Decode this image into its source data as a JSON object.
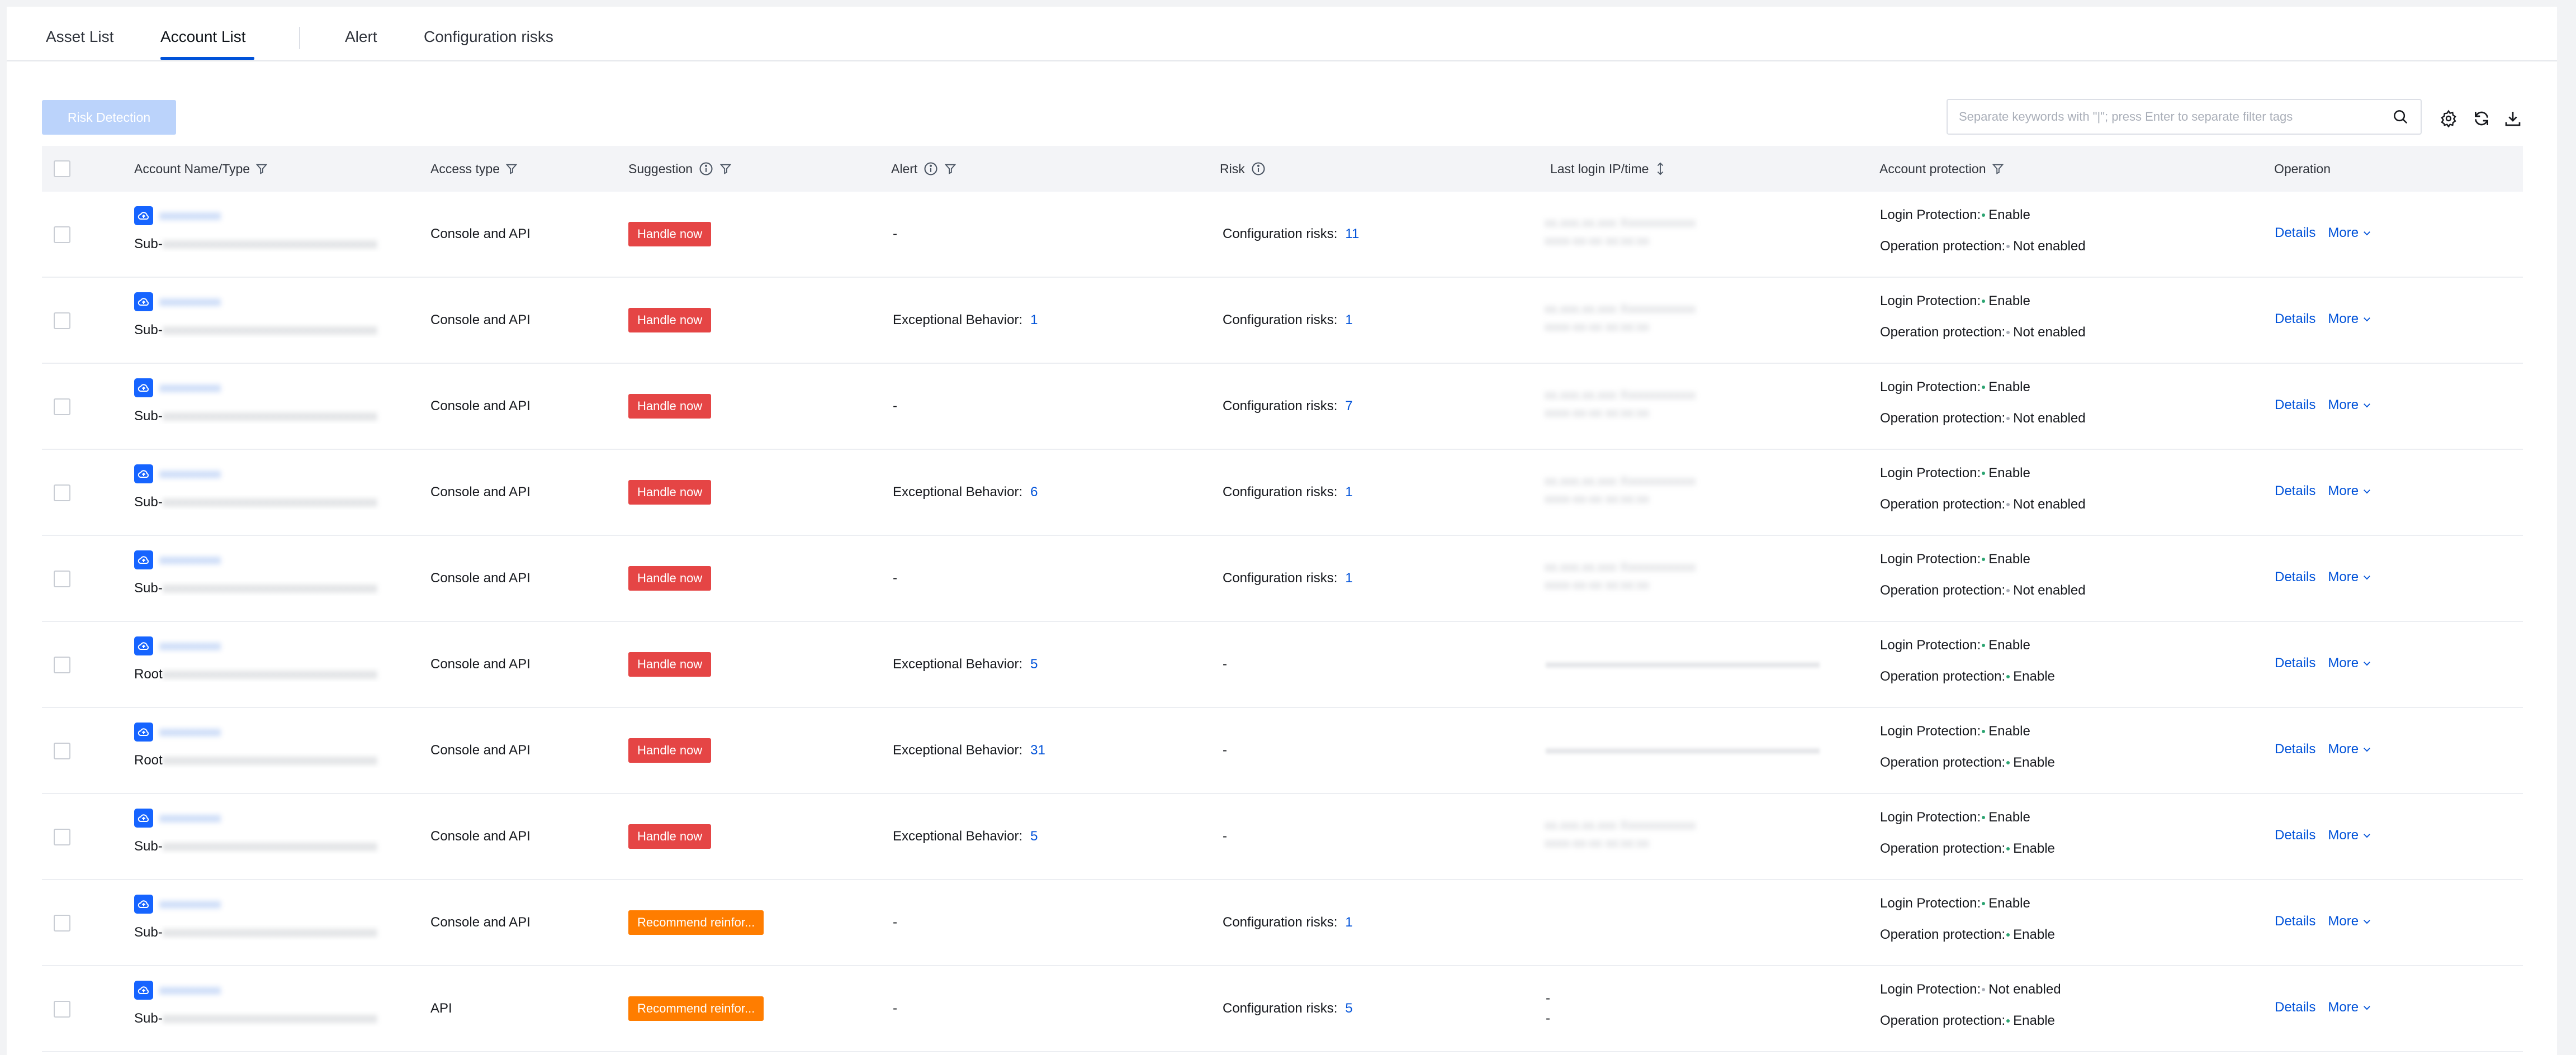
{
  "tabs": [
    {
      "label": "Asset List"
    },
    {
      "label": "Account List"
    },
    {
      "label": "Alert"
    },
    {
      "label": "Configuration risks"
    }
  ],
  "toolbar": {
    "risk_button": "Risk Detection",
    "search_placeholder": "Separate keywords with \"|\"; press Enter to separate filter tags"
  },
  "columns": {
    "account": "Account Name/Type",
    "access": "Access type",
    "suggestion": "Suggestion",
    "alert": "Alert",
    "risk": "Risk",
    "login": "Last login IP/time",
    "protection": "Account protection",
    "operation": "Operation"
  },
  "labels": {
    "login_protection": "Login Protection:",
    "operation_protection": "Operation protection:",
    "details": "Details",
    "more": "More",
    "exceptional": "Exceptional Behavior:",
    "config_risks": "Configuration risks:"
  },
  "colors": {
    "accent": "#0052d9",
    "danger": "#e54545",
    "warning": "#ff7d00"
  },
  "rows": [
    {
      "type": "Sub-",
      "access": "Console and API",
      "suggestion": "Handle now",
      "suggestion_level": "red",
      "alert": "-",
      "risk": "Configuration risks:",
      "risk_num": "11",
      "login_protection": "Enable",
      "operation_protection": "Not enabled"
    },
    {
      "type": "Sub-",
      "access": "Console and API",
      "suggestion": "Handle now",
      "suggestion_level": "red",
      "alert": "Exceptional Behavior:",
      "alert_num": "1",
      "risk": "Configuration risks:",
      "risk_num": "1",
      "login_protection": "Enable",
      "operation_protection": "Not enabled"
    },
    {
      "type": "Sub-",
      "access": "Console and API",
      "suggestion": "Handle now",
      "suggestion_level": "red",
      "alert": "-",
      "risk": "Configuration risks:",
      "risk_num": "7",
      "login_protection": "Enable",
      "operation_protection": "Not enabled"
    },
    {
      "type": "Sub-",
      "access": "Console and API",
      "suggestion": "Handle now",
      "suggestion_level": "red",
      "alert": "Exceptional Behavior:",
      "alert_num": "6",
      "risk": "Configuration risks:",
      "risk_num": "1",
      "login_protection": "Enable",
      "operation_protection": "Not enabled"
    },
    {
      "type": "Sub-",
      "access": "Console and API",
      "suggestion": "Handle now",
      "suggestion_level": "red",
      "alert": "-",
      "risk": "Configuration risks:",
      "risk_num": "1",
      "login_protection": "Enable",
      "operation_protection": "Not enabled"
    },
    {
      "type": "Root",
      "access": "Console and API",
      "suggestion": "Handle now",
      "suggestion_level": "red",
      "alert": "Exceptional Behavior:",
      "alert_num": "5",
      "risk": "-",
      "login_protection": "Enable",
      "operation_protection": "Enable"
    },
    {
      "type": "Root",
      "access": "Console and API",
      "suggestion": "Handle now",
      "suggestion_level": "red",
      "alert": "Exceptional Behavior:",
      "alert_num": "31",
      "risk": "-",
      "login_protection": "Enable",
      "operation_protection": "Enable"
    },
    {
      "type": "Sub-",
      "access": "Console and API",
      "suggestion": "Handle now",
      "suggestion_level": "red",
      "alert": "Exceptional Behavior:",
      "alert_num": "5",
      "risk": "-",
      "login_protection": "Enable",
      "operation_protection": "Enable"
    },
    {
      "type": "Sub-",
      "access": "Console and API",
      "suggestion": "Recommend reinfor...",
      "suggestion_level": "orange",
      "alert": "-",
      "risk": "Configuration risks:",
      "risk_num": "1",
      "login_protection": "Enable",
      "operation_protection": "Enable"
    },
    {
      "type": "Sub-",
      "access": "API",
      "suggestion": "Recommend reinfor...",
      "suggestion_level": "orange",
      "alert": "-",
      "risk": "Configuration risks:",
      "risk_num": "5",
      "login_protection": "Not enabled",
      "operation_protection": "Enable",
      "login_dash": "-"
    }
  ]
}
